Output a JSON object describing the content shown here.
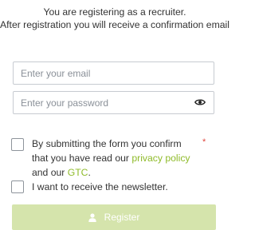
{
  "intro": {
    "line1": "You are registering as a recruiter.",
    "line2": "After registration you will receive a confirmation email"
  },
  "form": {
    "email_placeholder": "Enter your email",
    "password_placeholder": "Enter your password",
    "terms": {
      "text_before": "By submitting the form you confirm that you have read our ",
      "privacy_link": "privacy policy",
      "text_middle": " and our ",
      "gtc_link": "GTC",
      "text_after": ".",
      "required_mark": "*"
    },
    "newsletter_label": "I want to receive the newsletter.",
    "register_label": "Register",
    "icons": {
      "password_toggle": "eye-icon",
      "register": "user-icon"
    }
  },
  "colors": {
    "link": "#8fbb2a",
    "button_bg": "#d5e4ac",
    "required": "#e0453c"
  }
}
